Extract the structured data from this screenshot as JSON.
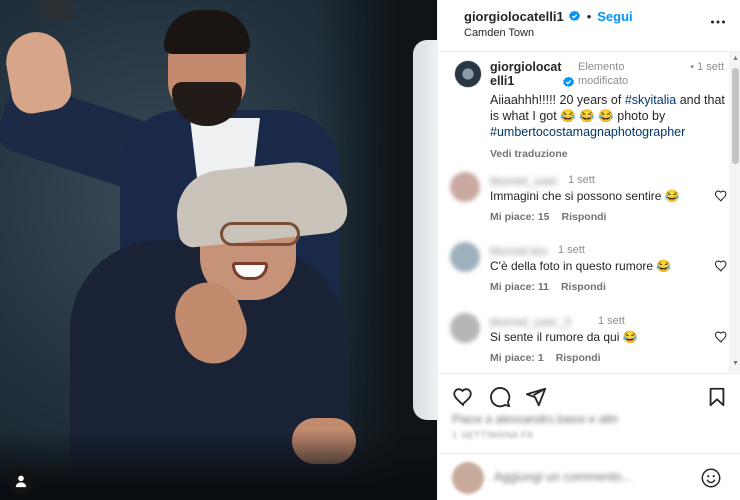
{
  "post": {
    "photo_alt": "Photo of two men in a studio"
  },
  "header": {
    "username": "giorgiolocatelli1",
    "separator": "•",
    "follow_label": "Segui",
    "location": "Camden Town",
    "more_icon": "more-horizontal-icon"
  },
  "caption": {
    "username": "giorgiolocatelli1",
    "edited_label": "Elemento modificato",
    "time_label": "• 1 sett",
    "text_prefix": "Aiiaahhh!!!!! 20 years of ",
    "hashtag1": "#skyitalia",
    "text_mid": " and that is what I got 😂 😂 😂 photo by",
    "hashtag2": "#umbertocostamagnaphotographer",
    "translate_label": "Vedi traduzione"
  },
  "comments": [
    {
      "username": "blurred_user",
      "time": "1 sett",
      "text": "Immagini che si possono sentire 😂",
      "likes": "Mi piace: 15",
      "reply": "Rispondi",
      "avatar_color": "#c9a8a0"
    },
    {
      "username": "blurred.teo",
      "time": "1 sett",
      "text": "C'è della foto in questo rumore 😂",
      "likes": "Mi piace: 11",
      "reply": "Rispondi",
      "avatar_color": "#9db0bd"
    },
    {
      "username": "blurred_user_3",
      "time": "1 sett",
      "text": "Si sente il rumore da qui 😂",
      "likes": "Mi piace: 1",
      "reply": "Rispondi",
      "avatar_color": "#b4b6b8"
    }
  ],
  "actions": {
    "like_icon": "heart-icon",
    "comment_icon": "comment-icon",
    "share_icon": "send-icon",
    "save_icon": "bookmark-icon"
  },
  "footer": {
    "likes_text": "Piace a alessandro.bassi e altri",
    "date_text": "1 SETTIMANA FA",
    "add_comment_placeholder": "Aggiungi un commento...",
    "emoji_icon": "emoji-icon"
  },
  "colors": {
    "accent": "#0095f6",
    "verified": "#0095f6",
    "hashtag": "#00376b"
  }
}
